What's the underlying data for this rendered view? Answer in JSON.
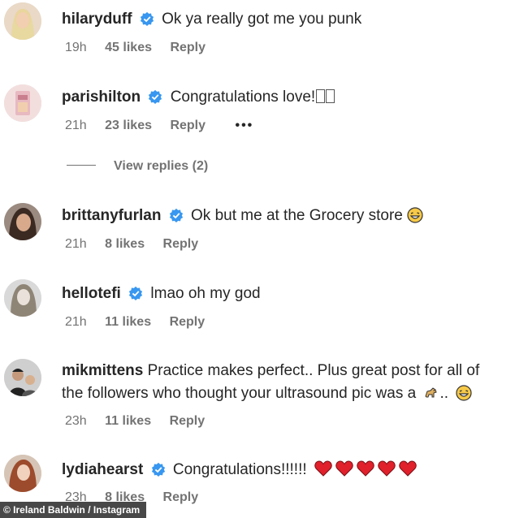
{
  "comments": [
    {
      "username": "hilaryduff",
      "verified": true,
      "text": "Ok ya really got me you punk",
      "time": "19h",
      "likes": "45 likes",
      "reply": "Reply"
    },
    {
      "username": "parishilton",
      "verified": true,
      "text": "Congratulations love!",
      "time": "21h",
      "likes": "23 likes",
      "reply": "Reply",
      "more": "•••"
    },
    {
      "username": "brittanyfurlan",
      "verified": true,
      "text": "Ok but me at the Grocery store",
      "time": "21h",
      "likes": "8 likes",
      "reply": "Reply"
    },
    {
      "username": "hellotefi",
      "verified": true,
      "text": "lmao oh my god",
      "time": "21h",
      "likes": "11 likes",
      "reply": "Reply"
    },
    {
      "username": "mikmittens",
      "verified": false,
      "text": "Practice makes perfect.. Plus great post for all of",
      "text2": "the followers who thought your ultrasound pic was a",
      "text2_suffix": "..",
      "time": "23h",
      "likes": "11 likes",
      "reply": "Reply"
    },
    {
      "username": "lydiahearst",
      "verified": true,
      "text": "Congratulations!!!!!!",
      "time": "23h",
      "likes": "8 likes",
      "reply": "Reply"
    }
  ],
  "view_replies": "View replies (2)",
  "credit": "© Ireland Baldwin / Instagram",
  "colors": {
    "verified": "#3897f0",
    "meta": "#737373",
    "heart": "#e0202b"
  }
}
